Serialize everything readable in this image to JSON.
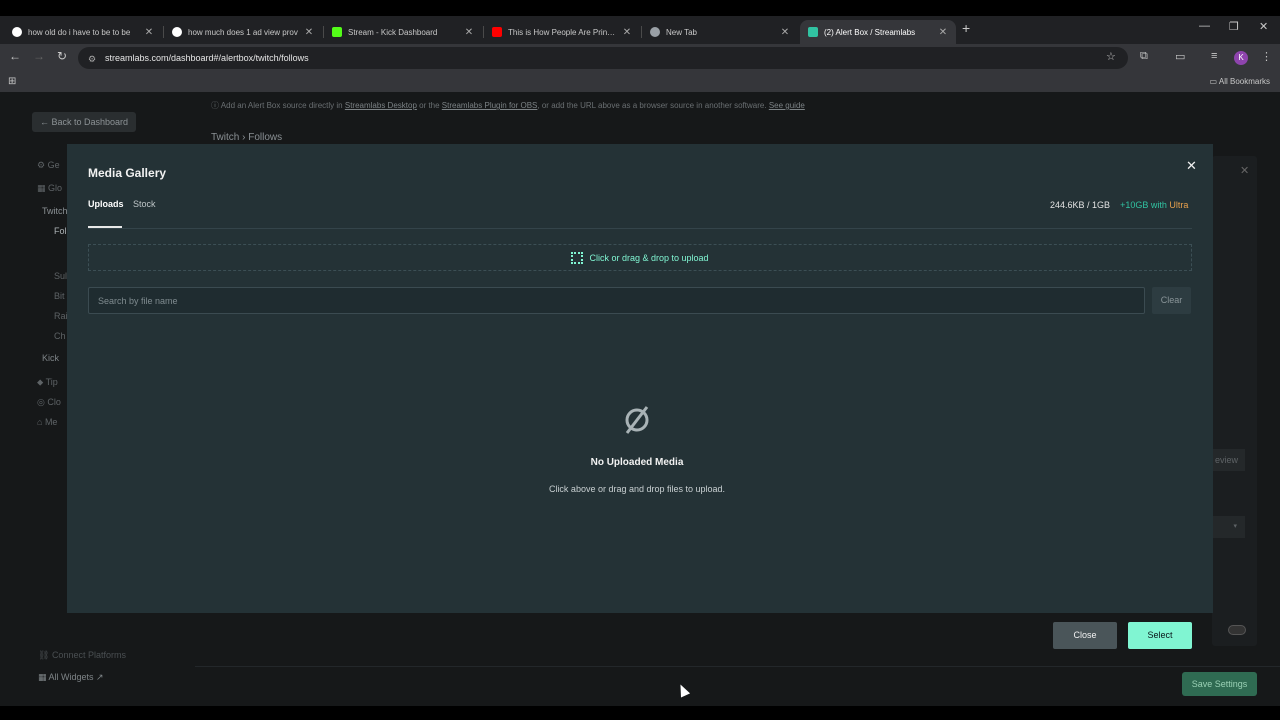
{
  "browser": {
    "tabs": [
      {
        "title": "how old do i have to be to be",
        "favicon_color": "#ffffff"
      },
      {
        "title": "how much does 1 ad view prov",
        "favicon_color": "#ffffff"
      },
      {
        "title": "Stream - Kick Dashboard",
        "favicon_color": "#53fc18"
      },
      {
        "title": "This is How People Are Printing",
        "favicon_color": "#ff0000"
      },
      {
        "title": "New Tab",
        "favicon_color": "#9aa0a6"
      },
      {
        "title": "(2) Alert Box / Streamlabs",
        "favicon_color": "#31c3a2"
      }
    ],
    "url": "streamlabs.com/dashboard#/alertbox/twitch/follows",
    "profile_initial": "K",
    "bookmarks_label": "All Bookmarks"
  },
  "page": {
    "info_prefix": "Add an Alert Box source directly in",
    "info_link1": "Streamlabs Desktop",
    "info_mid": " or the ",
    "info_link2": "Streamlabs Plugin for OBS",
    "info_suffix": ", or add the URL above as a browser source in another software.",
    "info_link3": "See guide",
    "back_label": "Back to Dashboard",
    "breadcrumb_platform": "Twitch",
    "breadcrumb_sep": "›",
    "breadcrumb_page": "Follows",
    "sidebar_fragments": [
      "Ge",
      "Glo",
      "Twitch",
      "Fol",
      "Sul",
      "Bit",
      "Rai",
      "Ch",
      "Kick",
      "Tip",
      "Clo",
      "Me"
    ],
    "connect_platforms": "Connect Platforms",
    "all_widgets": "All Widgets",
    "review_fragment": "eview",
    "save_settings": "Save Settings"
  },
  "modal": {
    "title": "Media Gallery",
    "tabs": [
      {
        "label": "Uploads",
        "active": true
      },
      {
        "label": "Stock",
        "active": false
      }
    ],
    "usage": "244.6KB / 1GB",
    "upgrade_prefix": "+10GB with",
    "upgrade_brand": "Ultra",
    "dropzone_label": "Click or drag & drop to upload",
    "search_placeholder": "Search by file name",
    "search_value": "",
    "clear_label": "Clear",
    "empty_title": "No Uploaded Media",
    "empty_subtitle": "Click above or drag and drop files to upload.",
    "close_label": "Close",
    "select_label": "Select",
    "accent_color": "#80f5d2"
  }
}
